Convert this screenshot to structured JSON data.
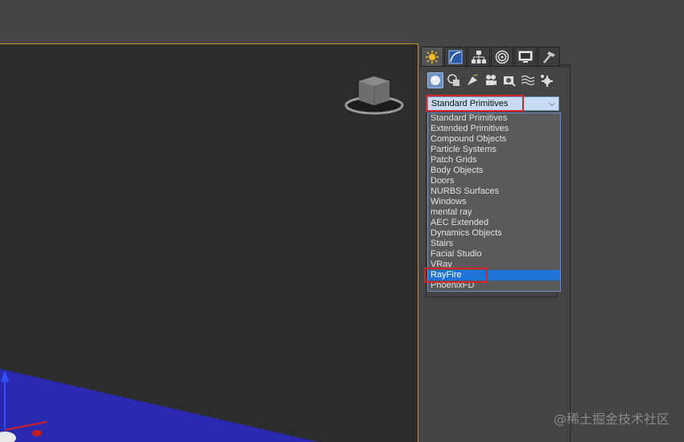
{
  "command_panel": {
    "tabs": [
      {
        "icon": "create-icon",
        "active": true
      },
      {
        "icon": "modify-icon",
        "active": false
      },
      {
        "icon": "hierarchy-icon",
        "active": false
      },
      {
        "icon": "motion-icon",
        "active": false
      },
      {
        "icon": "display-icon",
        "active": false
      },
      {
        "icon": "utilities-icon",
        "active": false
      }
    ],
    "category_icons": [
      {
        "icon": "geometry-icon",
        "active": true
      },
      {
        "icon": "shapes-icon",
        "active": false
      },
      {
        "icon": "lights-icon",
        "active": false
      },
      {
        "icon": "cameras-icon",
        "active": false
      },
      {
        "icon": "helpers-icon",
        "active": false
      },
      {
        "icon": "space-warps-icon",
        "active": false
      },
      {
        "icon": "systems-icon",
        "active": false
      }
    ],
    "combo": {
      "value": "Standard Primitives",
      "arrow": "⌵"
    },
    "dropdown_items": [
      "Standard Primitives",
      "Extended Primitives",
      "Compound Objects",
      "Particle Systems",
      "Patch Grids",
      "Body Objects",
      "Doors",
      "NURBS Surfaces",
      "Windows",
      "mental ray",
      "AEC Extended",
      "Dynamics Objects",
      "Stairs",
      "Facial Studio",
      "VRay",
      "RayFire",
      "PhoenixFD"
    ],
    "selected_item": "RayFire"
  },
  "colors": {
    "selection": "#1e74d6",
    "highlight_box": "#d7262b",
    "viewport_border": "#b9922e",
    "grid_plane": "#2a2ab0"
  },
  "watermark": "@稀土掘金技术社区"
}
